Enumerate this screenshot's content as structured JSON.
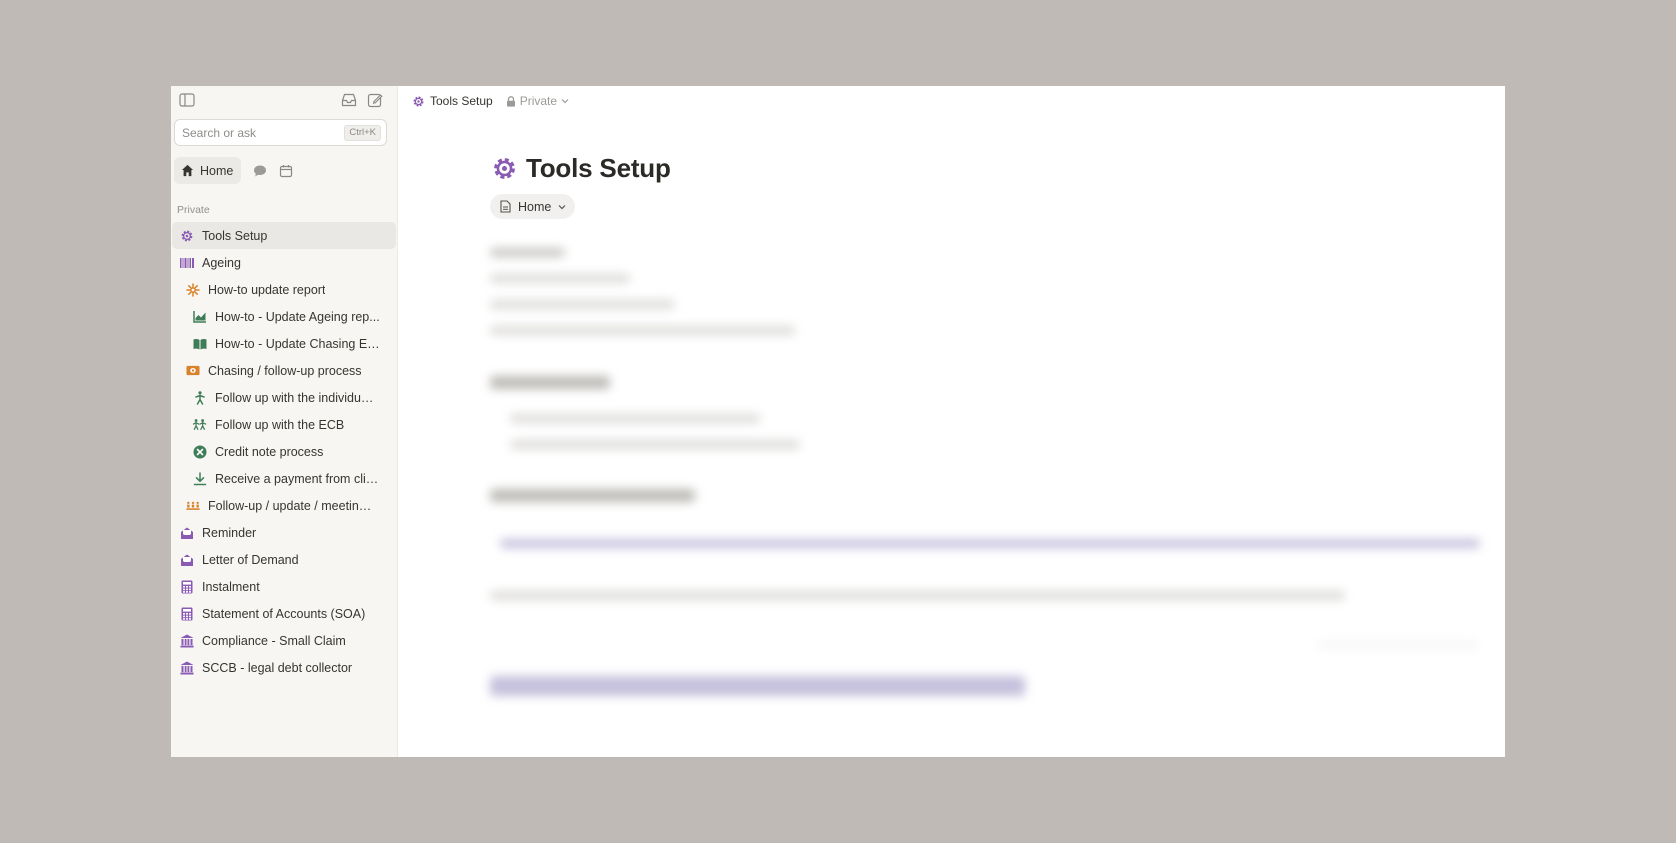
{
  "sidebar": {
    "search": {
      "placeholder": "Search or ask",
      "shortcut": "Ctrl+K"
    },
    "home_label": "Home",
    "section_label": "Private",
    "items": [
      {
        "label": "Tools Setup",
        "icon": "gear-icon",
        "color": "#8b5ab3",
        "level": 0,
        "active": true
      },
      {
        "label": "Ageing",
        "icon": "barcode-icon",
        "color": "#8b5ab3",
        "level": 0
      },
      {
        "label": "How-to update report",
        "icon": "sparkle-icon",
        "color": "#d9822b",
        "level": 1
      },
      {
        "label": "How-to - Update Ageing rep...",
        "icon": "chart-icon",
        "color": "#3f7d58",
        "level": 2
      },
      {
        "label": "How-to - Update Chasing Ex...",
        "icon": "book-icon",
        "color": "#3f7d58",
        "level": 2
      },
      {
        "label": "Chasing / follow-up process",
        "icon": "money-icon",
        "color": "#d9822b",
        "level": 1
      },
      {
        "label": "Follow up with the individual ...",
        "icon": "person-icon",
        "color": "#3f7d58",
        "level": 2
      },
      {
        "label": "Follow up with the ECB",
        "icon": "people-icon",
        "color": "#3f7d58",
        "level": 2
      },
      {
        "label": "Credit note process",
        "icon": "cancel-icon",
        "color": "#3f7d58",
        "level": 2
      },
      {
        "label": "Receive a payment from clients",
        "icon": "download-icon",
        "color": "#3f7d58",
        "level": 2
      },
      {
        "label": "Follow-up / update / meeting ...",
        "icon": "meeting-icon",
        "color": "#d9822b",
        "level": 1
      },
      {
        "label": "Reminder",
        "icon": "envelope-open-icon",
        "color": "#8b5ab3",
        "level": 0
      },
      {
        "label": "Letter of Demand",
        "icon": "envelope-open-icon",
        "color": "#8b5ab3",
        "level": 0
      },
      {
        "label": "Instalment",
        "icon": "calculator-icon",
        "color": "#8b5ab3",
        "level": 0
      },
      {
        "label": "Statement of Accounts (SOA)",
        "icon": "calculator-icon",
        "color": "#8b5ab3",
        "level": 0
      },
      {
        "label": "Compliance - Small Claim",
        "icon": "bank-icon",
        "color": "#8b5ab3",
        "level": 0
      },
      {
        "label": "SCCB - legal debt collector",
        "icon": "bank-icon",
        "color": "#8b5ab3",
        "level": 0
      }
    ]
  },
  "breadcrumb": {
    "title": "Tools Setup",
    "privacy": "Private"
  },
  "page": {
    "title": "Tools Setup",
    "parent_label": "Home"
  },
  "colors": {
    "purple": "#8b5ab3",
    "orange": "#d9822b",
    "green": "#3f7d58"
  }
}
